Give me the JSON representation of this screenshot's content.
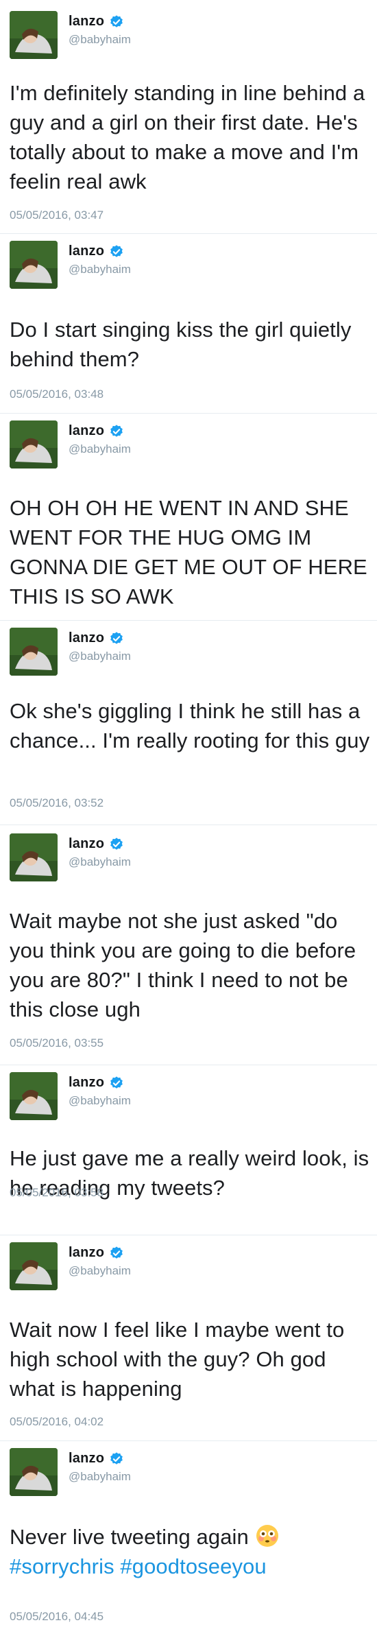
{
  "author": {
    "name": "lanzo",
    "handle": "@babyhaim",
    "verified": true,
    "verified_color": "#1da1f2"
  },
  "colors": {
    "text": "#1c1e21",
    "muted": "#8899a6",
    "hashtag": "#1b95e0"
  },
  "tweets": [
    {
      "text": "I'm definitely standing in line behind a guy and a girl on their first date. He's totally about to make a move and I'm feelin real awk",
      "timestamp": "05/05/2016, 03:47"
    },
    {
      "text": "Do I start singing kiss the girl quietly behind them?",
      "timestamp": "05/05/2016, 03:48"
    },
    {
      "text": "OH OH OH HE WENT IN AND SHE WENT FOR THE HUG OMG IM GONNA DIE GET ME OUT OF HERE THIS IS SO AWK",
      "timestamp": ""
    },
    {
      "text": "Ok she's giggling I think he still has a chance... I'm really rooting for this guy",
      "timestamp": "05/05/2016, 03:52"
    },
    {
      "text": "Wait maybe not she just asked \"do you think you are going to die before you are 80?\" I think I need to not be this close ugh",
      "timestamp": "05/05/2016, 03:55"
    },
    {
      "text": "He just gave me a really weird look, is he reading my tweets?",
      "timestamp": "05/05/2016, 03:58"
    },
    {
      "text": "Wait now I feel like I maybe went to high school with the guy? Oh god what is happening",
      "timestamp": "05/05/2016, 04:02"
    },
    {
      "text": "Never live tweeting again",
      "emoji": "flushed-face",
      "hashtags": [
        "#sorrychris",
        "#goodtoseeyou"
      ],
      "timestamp": "05/05/2016, 04:45"
    }
  ]
}
